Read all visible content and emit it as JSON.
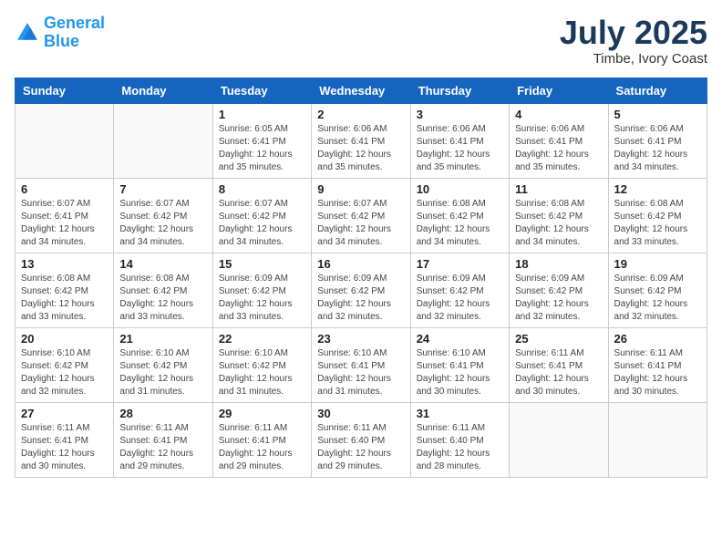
{
  "logo": {
    "line1": "General",
    "line2": "Blue"
  },
  "title": "July 2025",
  "subtitle": "Timbe, Ivory Coast",
  "weekdays": [
    "Sunday",
    "Monday",
    "Tuesday",
    "Wednesday",
    "Thursday",
    "Friday",
    "Saturday"
  ],
  "weeks": [
    [
      {
        "day": "",
        "info": ""
      },
      {
        "day": "",
        "info": ""
      },
      {
        "day": "1",
        "info": "Sunrise: 6:05 AM\nSunset: 6:41 PM\nDaylight: 12 hours\nand 35 minutes."
      },
      {
        "day": "2",
        "info": "Sunrise: 6:06 AM\nSunset: 6:41 PM\nDaylight: 12 hours\nand 35 minutes."
      },
      {
        "day": "3",
        "info": "Sunrise: 6:06 AM\nSunset: 6:41 PM\nDaylight: 12 hours\nand 35 minutes."
      },
      {
        "day": "4",
        "info": "Sunrise: 6:06 AM\nSunset: 6:41 PM\nDaylight: 12 hours\nand 35 minutes."
      },
      {
        "day": "5",
        "info": "Sunrise: 6:06 AM\nSunset: 6:41 PM\nDaylight: 12 hours\nand 34 minutes."
      }
    ],
    [
      {
        "day": "6",
        "info": "Sunrise: 6:07 AM\nSunset: 6:41 PM\nDaylight: 12 hours\nand 34 minutes."
      },
      {
        "day": "7",
        "info": "Sunrise: 6:07 AM\nSunset: 6:42 PM\nDaylight: 12 hours\nand 34 minutes."
      },
      {
        "day": "8",
        "info": "Sunrise: 6:07 AM\nSunset: 6:42 PM\nDaylight: 12 hours\nand 34 minutes."
      },
      {
        "day": "9",
        "info": "Sunrise: 6:07 AM\nSunset: 6:42 PM\nDaylight: 12 hours\nand 34 minutes."
      },
      {
        "day": "10",
        "info": "Sunrise: 6:08 AM\nSunset: 6:42 PM\nDaylight: 12 hours\nand 34 minutes."
      },
      {
        "day": "11",
        "info": "Sunrise: 6:08 AM\nSunset: 6:42 PM\nDaylight: 12 hours\nand 34 minutes."
      },
      {
        "day": "12",
        "info": "Sunrise: 6:08 AM\nSunset: 6:42 PM\nDaylight: 12 hours\nand 33 minutes."
      }
    ],
    [
      {
        "day": "13",
        "info": "Sunrise: 6:08 AM\nSunset: 6:42 PM\nDaylight: 12 hours\nand 33 minutes."
      },
      {
        "day": "14",
        "info": "Sunrise: 6:08 AM\nSunset: 6:42 PM\nDaylight: 12 hours\nand 33 minutes."
      },
      {
        "day": "15",
        "info": "Sunrise: 6:09 AM\nSunset: 6:42 PM\nDaylight: 12 hours\nand 33 minutes."
      },
      {
        "day": "16",
        "info": "Sunrise: 6:09 AM\nSunset: 6:42 PM\nDaylight: 12 hours\nand 32 minutes."
      },
      {
        "day": "17",
        "info": "Sunrise: 6:09 AM\nSunset: 6:42 PM\nDaylight: 12 hours\nand 32 minutes."
      },
      {
        "day": "18",
        "info": "Sunrise: 6:09 AM\nSunset: 6:42 PM\nDaylight: 12 hours\nand 32 minutes."
      },
      {
        "day": "19",
        "info": "Sunrise: 6:09 AM\nSunset: 6:42 PM\nDaylight: 12 hours\nand 32 minutes."
      }
    ],
    [
      {
        "day": "20",
        "info": "Sunrise: 6:10 AM\nSunset: 6:42 PM\nDaylight: 12 hours\nand 32 minutes."
      },
      {
        "day": "21",
        "info": "Sunrise: 6:10 AM\nSunset: 6:42 PM\nDaylight: 12 hours\nand 31 minutes."
      },
      {
        "day": "22",
        "info": "Sunrise: 6:10 AM\nSunset: 6:42 PM\nDaylight: 12 hours\nand 31 minutes."
      },
      {
        "day": "23",
        "info": "Sunrise: 6:10 AM\nSunset: 6:41 PM\nDaylight: 12 hours\nand 31 minutes."
      },
      {
        "day": "24",
        "info": "Sunrise: 6:10 AM\nSunset: 6:41 PM\nDaylight: 12 hours\nand 30 minutes."
      },
      {
        "day": "25",
        "info": "Sunrise: 6:11 AM\nSunset: 6:41 PM\nDaylight: 12 hours\nand 30 minutes."
      },
      {
        "day": "26",
        "info": "Sunrise: 6:11 AM\nSunset: 6:41 PM\nDaylight: 12 hours\nand 30 minutes."
      }
    ],
    [
      {
        "day": "27",
        "info": "Sunrise: 6:11 AM\nSunset: 6:41 PM\nDaylight: 12 hours\nand 30 minutes."
      },
      {
        "day": "28",
        "info": "Sunrise: 6:11 AM\nSunset: 6:41 PM\nDaylight: 12 hours\nand 29 minutes."
      },
      {
        "day": "29",
        "info": "Sunrise: 6:11 AM\nSunset: 6:41 PM\nDaylight: 12 hours\nand 29 minutes."
      },
      {
        "day": "30",
        "info": "Sunrise: 6:11 AM\nSunset: 6:40 PM\nDaylight: 12 hours\nand 29 minutes."
      },
      {
        "day": "31",
        "info": "Sunrise: 6:11 AM\nSunset: 6:40 PM\nDaylight: 12 hours\nand 28 minutes."
      },
      {
        "day": "",
        "info": ""
      },
      {
        "day": "",
        "info": ""
      }
    ]
  ]
}
